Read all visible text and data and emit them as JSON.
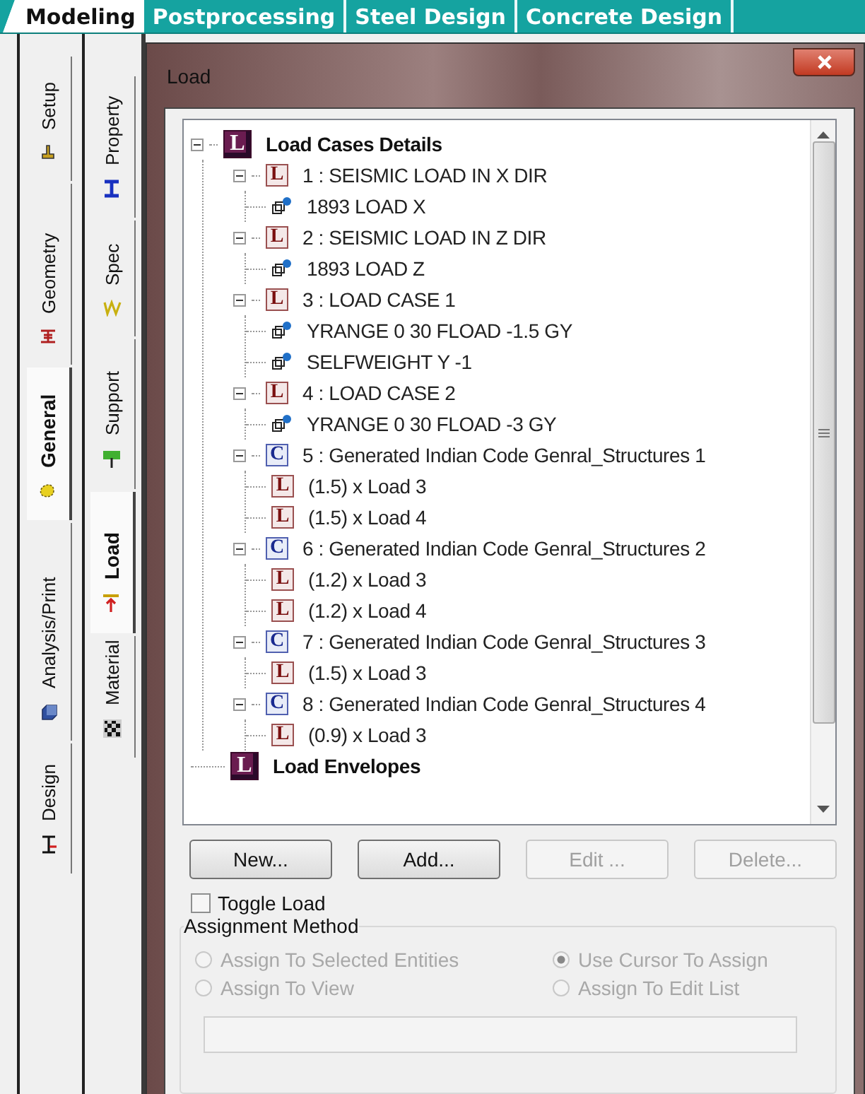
{
  "top_tabs": [
    {
      "label": "Modeling",
      "selected": true
    },
    {
      "label": "Postprocessing",
      "selected": false
    },
    {
      "label": "Steel Design",
      "selected": false
    },
    {
      "label": "Concrete Design",
      "selected": false
    }
  ],
  "side_tabs": [
    {
      "label": "Setup",
      "selected": false
    },
    {
      "label": "Geometry",
      "selected": false
    },
    {
      "label": "General",
      "selected": true
    },
    {
      "label": "Analysis/Print",
      "selected": false
    },
    {
      "label": "Design",
      "selected": false
    }
  ],
  "sub_tabs": [
    {
      "label": "Property",
      "selected": false
    },
    {
      "label": "Spec",
      "selected": false
    },
    {
      "label": "Support",
      "selected": false
    },
    {
      "label": "Load",
      "selected": true
    },
    {
      "label": "Material",
      "selected": false
    }
  ],
  "dialog": {
    "title": "Load",
    "tree": [
      {
        "kind": "group",
        "badge": "L",
        "label": "Load Cases Details",
        "expanded": true,
        "children": [
          {
            "kind": "load",
            "badge": "L",
            "label": "1 : SEISMIC LOAD IN X DIR",
            "expanded": true,
            "children": [
              {
                "kind": "item",
                "label": "1893 LOAD X"
              }
            ]
          },
          {
            "kind": "load",
            "badge": "L",
            "label": "2 : SEISMIC LOAD IN Z DIR",
            "expanded": true,
            "children": [
              {
                "kind": "item",
                "label": "1893 LOAD Z"
              }
            ]
          },
          {
            "kind": "load",
            "badge": "L",
            "label": "3 : LOAD CASE 1",
            "expanded": true,
            "children": [
              {
                "kind": "item",
                "label": "YRANGE 0 30 FLOAD -1.5 GY"
              },
              {
                "kind": "item",
                "label": "SELFWEIGHT Y -1"
              }
            ]
          },
          {
            "kind": "load",
            "badge": "L",
            "label": "4 : LOAD CASE 2",
            "expanded": true,
            "children": [
              {
                "kind": "item",
                "label": "YRANGE 0 30 FLOAD -3 GY"
              }
            ]
          },
          {
            "kind": "combination",
            "badge": "C",
            "label": "5 : Generated Indian Code Genral_Structures 1",
            "expanded": true,
            "children": [
              {
                "kind": "load",
                "badge": "L",
                "label": "(1.5) x Load 3"
              },
              {
                "kind": "load",
                "badge": "L",
                "label": "(1.5) x Load 4"
              }
            ]
          },
          {
            "kind": "combination",
            "badge": "C",
            "label": "6 : Generated Indian Code Genral_Structures 2",
            "expanded": true,
            "children": [
              {
                "kind": "load",
                "badge": "L",
                "label": "(1.2) x Load 3"
              },
              {
                "kind": "load",
                "badge": "L",
                "label": "(1.2) x Load 4"
              }
            ]
          },
          {
            "kind": "combination",
            "badge": "C",
            "label": "7 : Generated Indian Code Genral_Structures 3",
            "expanded": true,
            "children": [
              {
                "kind": "load",
                "badge": "L",
                "label": "(1.5) x Load 3"
              }
            ]
          },
          {
            "kind": "combination",
            "badge": "C",
            "label": "8 : Generated Indian Code Genral_Structures 4",
            "expanded": true,
            "children": [
              {
                "kind": "load",
                "badge": "L",
                "label": "(0.9) x Load 3"
              }
            ]
          }
        ]
      },
      {
        "kind": "group",
        "badge": "L",
        "label": "Load Envelopes"
      }
    ],
    "buttons": [
      {
        "label": "New...",
        "disabled": false
      },
      {
        "label": "Add...",
        "disabled": false
      },
      {
        "label": "Edit ...",
        "disabled": true
      },
      {
        "label": "Delete...",
        "disabled": true
      }
    ],
    "toggle_load": {
      "label": "Toggle Load",
      "checked": false
    },
    "assignment_method": {
      "title": "Assignment Method",
      "options": [
        {
          "label": "Assign To Selected Entities",
          "selected": false,
          "disabled": true
        },
        {
          "label": "Use Cursor To Assign",
          "selected": true,
          "disabled": true
        },
        {
          "label": "Assign To View",
          "selected": false,
          "disabled": true
        },
        {
          "label": "Assign To Edit List",
          "selected": false,
          "disabled": true
        }
      ],
      "field": {
        "disabled": true
      }
    }
  }
}
